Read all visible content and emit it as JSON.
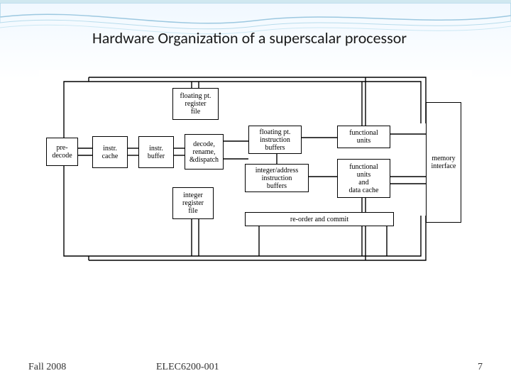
{
  "title": "Hardware Organization of a superscalar processor",
  "footer": {
    "left": "Fall 2008",
    "center": "ELEC6200-001",
    "page": "7"
  },
  "blocks": {
    "predecode": "pre-\ndecode",
    "icache": "instr.\ncache",
    "ibuffer": "instr.\nbuffer",
    "dispatch": "decode,\nrename,\n&dispatch",
    "fpreg": "floating pt.\nregister\nfile",
    "intreg": "integer\nregister\nfile",
    "fpbuf": "floating pt.\ninstruction\nbuffers",
    "intbuf": "integer/address\ninstruction\nbuffers",
    "funits1": "functional\nunits",
    "funits2": "functional\nunits\nand\ndata cache",
    "reorder": "re-order and commit",
    "memif": "memory\ninterface"
  }
}
